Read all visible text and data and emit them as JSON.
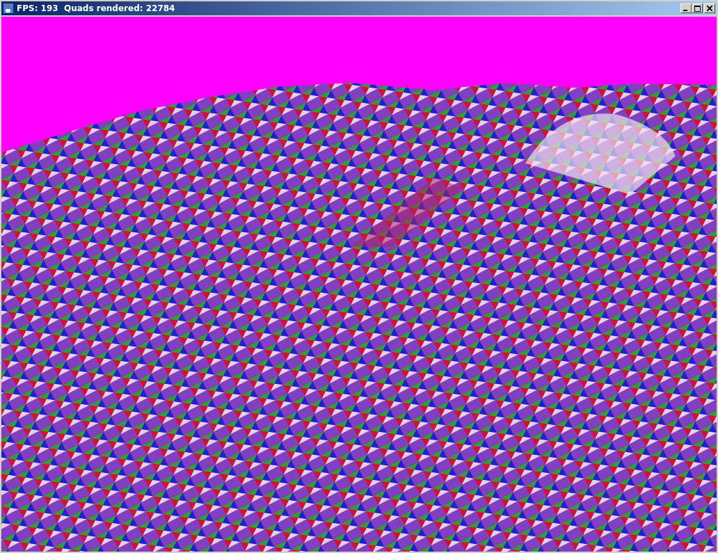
{
  "window": {
    "title": "FPS: 193  Quads rendered: 22784"
  }
}
